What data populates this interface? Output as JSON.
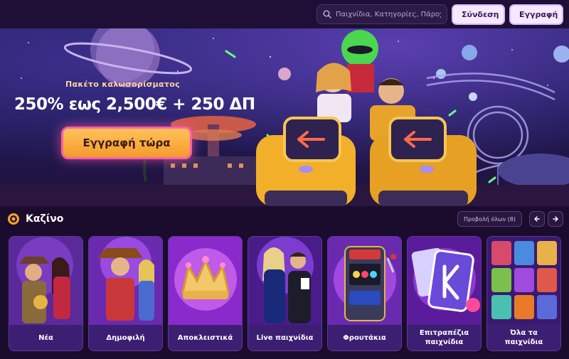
{
  "header": {
    "search_placeholder": "Παιχνίδια, Κατηγορίες, Πάροχοι",
    "login_label": "Σύνδεση",
    "register_label": "Εγγραφή"
  },
  "hero": {
    "promo_subtitle": "Πακέτο καλωσορίσματος",
    "promo_title": "250% εως 2,500€ + 250 ΔΠ",
    "cta_label": "Εγγραφή τώρα"
  },
  "section": {
    "title": "Καζίνο",
    "view_all_label": "Προβολή όλων (8)",
    "cards": [
      {
        "label": "Νέα"
      },
      {
        "label": "Δημοφιλή"
      },
      {
        "label": "Αποκλειστικά"
      },
      {
        "label": "Live παιχνίδια"
      },
      {
        "label": "Φρουτάκια"
      },
      {
        "label": "Επιτραπέζια παιχνίδια"
      },
      {
        "label": "Όλα τα παιχνίδια"
      }
    ]
  },
  "colors": {
    "background": "#1b0c30",
    "accent": "#f49b2c",
    "button_light": "#f6e9ff",
    "card_label_bg": "#3c1f72"
  },
  "icons": [
    "search-icon",
    "casino-chip-icon",
    "arrow-left-icon",
    "arrow-right-icon"
  ]
}
